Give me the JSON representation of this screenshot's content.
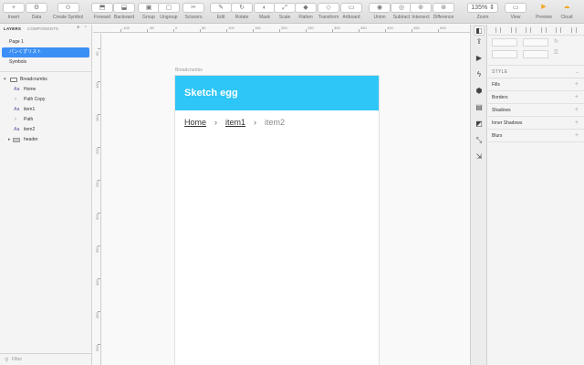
{
  "toolbar": {
    "items": [
      {
        "label": "Insert",
        "glyph": "+",
        "icon": "insert-icon"
      },
      {
        "label": "Data",
        "glyph": "⚙",
        "icon": "data-icon"
      },
      {
        "label": "Create Symbol",
        "glyph": "⊙",
        "icon": "create-symbol-icon"
      },
      {
        "label": "Forward",
        "glyph": "⬒",
        "icon": "forward-icon"
      },
      {
        "label": "Backward",
        "glyph": "⬓",
        "icon": "backward-icon"
      },
      {
        "label": "Group",
        "glyph": "▣",
        "icon": "group-icon"
      },
      {
        "label": "Ungroup",
        "glyph": "▢",
        "icon": "ungroup-icon"
      },
      {
        "label": "Scissors",
        "glyph": "✂",
        "icon": "scissors-icon"
      },
      {
        "label": "Edit",
        "glyph": "✎",
        "icon": "edit-icon"
      },
      {
        "label": "Rotate",
        "glyph": "↻",
        "icon": "rotate-icon"
      },
      {
        "label": "Mask",
        "glyph": "◐",
        "icon": "mask-icon"
      },
      {
        "label": "Scale",
        "glyph": "⤢",
        "icon": "scale-icon"
      },
      {
        "label": "Flatten",
        "glyph": "◆",
        "icon": "flatten-icon"
      },
      {
        "label": "Transform",
        "glyph": "◇",
        "icon": "transform-icon"
      },
      {
        "label": "Artboard",
        "glyph": "▭",
        "icon": "artboard-icon"
      },
      {
        "label": "Union",
        "glyph": "◉",
        "icon": "union-icon"
      },
      {
        "label": "Subtract",
        "glyph": "◎",
        "icon": "subtract-icon"
      },
      {
        "label": "Intersect",
        "glyph": "⊚",
        "icon": "intersect-icon"
      },
      {
        "label": "Difference",
        "glyph": "⊛",
        "icon": "difference-icon"
      }
    ],
    "zoom": {
      "label": "Zoom",
      "value": "135%"
    },
    "view": {
      "label": "View"
    },
    "preview": {
      "label": "Preview"
    },
    "cloud": {
      "label": "Cloud"
    }
  },
  "left_panel": {
    "tabs": {
      "layers": "LAYERS",
      "components": "COMPONENTS",
      "add": "+"
    },
    "pages": [
      "Page 1",
      "パンくずリスト",
      "Symbols"
    ],
    "selected_page_index": 1,
    "layers": [
      {
        "label": "Breadcrumbs",
        "type": "artboard",
        "depth": 0,
        "expanded": true
      },
      {
        "label": "Home",
        "type": "text",
        "depth": 1
      },
      {
        "label": "Path Copy",
        "type": "path",
        "depth": 1
      },
      {
        "label": "item1",
        "type": "text",
        "depth": 1
      },
      {
        "label": "Path",
        "type": "path",
        "depth": 1
      },
      {
        "label": "item2",
        "type": "text",
        "depth": 1
      },
      {
        "label": "header",
        "type": "group",
        "depth": 1,
        "expanded": false
      }
    ],
    "filter_placeholder": "Filter",
    "text_icon": "Aa"
  },
  "rulers": {
    "top_ticks": [
      "-100",
      "-50",
      "0",
      "50",
      "100",
      "150",
      "200",
      "250",
      "300",
      "350",
      "400",
      "450",
      "500"
    ],
    "left_ticks": [
      "50",
      "100",
      "150",
      "200",
      "250",
      "300",
      "350",
      "400",
      "450",
      "500"
    ]
  },
  "canvas": {
    "artboard_name": "Breadcrumbs",
    "header_title": "Sketch egg",
    "header_color": "#2ec5f7",
    "breadcrumbs": {
      "home": "Home",
      "item1": "item1",
      "item2": "item2",
      "separator": "›"
    }
  },
  "inspector": {
    "style_label": "STYLE",
    "sections": [
      "Fills",
      "Borders",
      "Shadows",
      "Inner Shadows",
      "Blurs"
    ],
    "plus": "+"
  },
  "colors": {
    "selection": "#3b8ff5",
    "preview": "#f5a623",
    "cloud": "#f5a623"
  }
}
